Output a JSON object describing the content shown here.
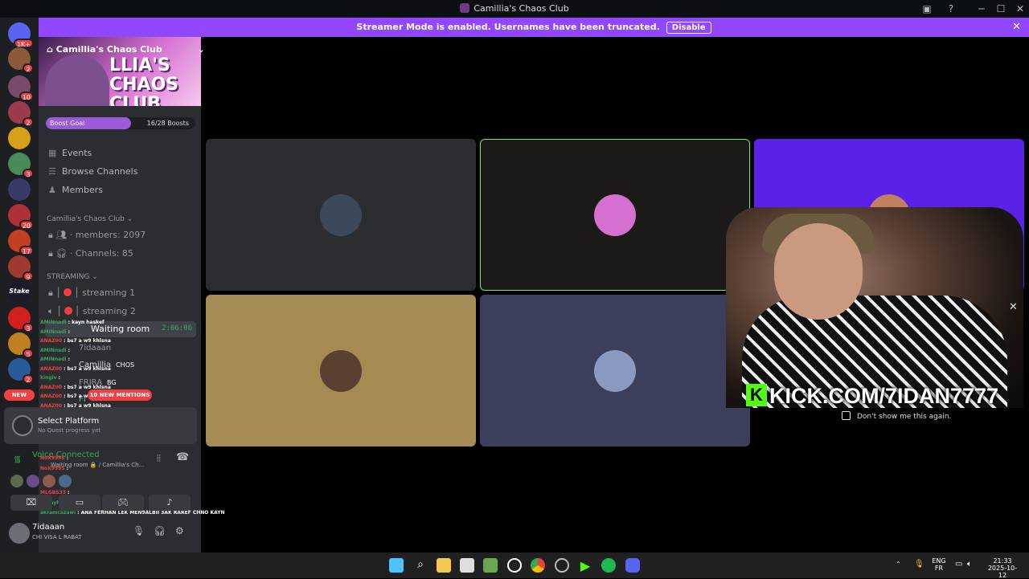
{
  "window": {
    "title": "Camillia's Chaos Club"
  },
  "banner": {
    "text": "Streamer Mode is enabled. Usernames have been truncated.",
    "button": "Disable"
  },
  "servers": [
    {
      "badge": "1K+",
      "color": "#5865f2"
    },
    {
      "badge": "2",
      "color": "#8a5a3a"
    },
    {
      "badge": "10",
      "color": "#7a4a6a"
    },
    {
      "badge": "2",
      "color": "#9a3a4a"
    },
    {
      "badge": "",
      "color": "#d4a017"
    },
    {
      "badge": "3",
      "color": "#4a8a5a"
    },
    {
      "badge": "",
      "color": "#3a3a6a"
    },
    {
      "badge": "20",
      "color": "#b0303a"
    },
    {
      "badge": "17",
      "color": "#c04020"
    },
    {
      "badge": "9",
      "color": "#a03a30"
    },
    {
      "badge": "",
      "color": "#1a1a2a",
      "label": "Stake"
    },
    {
      "badge": "3",
      "color": "#d02020"
    },
    {
      "badge": "5",
      "color": "#c08020"
    },
    {
      "badge": "2",
      "color": "#2a5a9a"
    }
  ],
  "guild": {
    "name": "Camillia's Chaos Club",
    "banner_text": "CHAOS CLUB",
    "banner_top": "LLIA'S",
    "boost_label": "Boost Goal",
    "boost_count": "16/28 Boosts",
    "boost_progress": 0.57
  },
  "nav": {
    "events": "Events",
    "browse": "Browse Channels",
    "members": "Members"
  },
  "category1": {
    "label": "Camillia's Chaos Club",
    "ch1": "members: 2097",
    "ch2": "Channels: 85"
  },
  "category2": {
    "label": "STREAMING",
    "ch1": "streaming 1",
    "ch2": "streaming 2"
  },
  "waiting_room": {
    "name": "Waiting room",
    "time": "2:06:06"
  },
  "vc_users": [
    {
      "name": "7idaaan",
      "tag": ""
    },
    {
      "name": "Camillia",
      "tag": "CHOS"
    },
    {
      "name": "FRIRA",
      "tag": "BG"
    },
    {
      "name": "FI",
      "tag": ""
    }
  ],
  "chat": [
    {
      "user": "AMINnadi",
      "msg": "kayn haskef"
    },
    {
      "user": "AMINnadi",
      "msg": ""
    },
    {
      "user": "ANAZ00",
      "msg": "bs7 a w9 khlsna"
    },
    {
      "user": "AMINnadi",
      "msg": ""
    },
    {
      "user": "AMINnadi",
      "msg": ""
    },
    {
      "user": "ANAZ00",
      "msg": "bs7 a w9 khlsna"
    },
    {
      "user": "kingiv",
      "msg": ""
    },
    {
      "user": "ANAZ00",
      "msg": "bs7 a w9 khlsna"
    },
    {
      "user": "ANAZ00",
      "msg": "bs7 a w9 khlsna"
    },
    {
      "user": "ANAZ00",
      "msg": "bs7 a w9 khlsna"
    },
    {
      "user": "ANAZ00",
      "msg": "bs7 a w9 khlsna"
    },
    {
      "user": "ANAZ00",
      "msg": "bs7 a w9 khlsna"
    },
    {
      "user": "ANAZ00",
      "msg": "bs7 a w9 khlsna"
    }
  ],
  "chat_bottom": [
    {
      "user": "NoX999S",
      "msg": ""
    },
    {
      "user": "NoX999S",
      "msg": ""
    },
    {
      "user": "MLGBS33",
      "msg": ""
    },
    {
      "user": "BG_ayham",
      "msg": "hallo mad"
    },
    {
      "user": "akramcazawi",
      "msg": "ANA FERHAN LEK MEN9ALBII 3AK RAREF CHNO KAYN"
    }
  ],
  "new_pill": "NEW",
  "mentions": "10 NEW MENTIONS",
  "platform": {
    "title": "Select Platform",
    "sub": "No Quest progress yet"
  },
  "voice": {
    "status": "Voice Connected",
    "where": "Waiting room 🔒 / Camillia's Ch..."
  },
  "user": {
    "name": "7idaaan",
    "status": "CHI VISA L RABAT"
  },
  "tiles": [
    {
      "bg": "#2b2d31",
      "av": "#3a4a5a",
      "border": ""
    },
    {
      "bg": "#1c1a18",
      "av": "#d56fd0",
      "border": "#57f287"
    },
    {
      "bg": "#5b21e8",
      "av": "#c08060",
      "border": ""
    },
    {
      "bg": "#a58a53",
      "av": "#5a4030",
      "border": ""
    },
    {
      "bg": "#3b3f5c",
      "av": "#8a9ac0",
      "border": ""
    }
  ],
  "overlay": {
    "kick": "KICK.COM/7IDAN7777",
    "dont_show": "Don't show me this again."
  },
  "tray": {
    "lang1": "ENG",
    "lang2": "FR",
    "time": "21:33",
    "date": "2025-10-12"
  }
}
